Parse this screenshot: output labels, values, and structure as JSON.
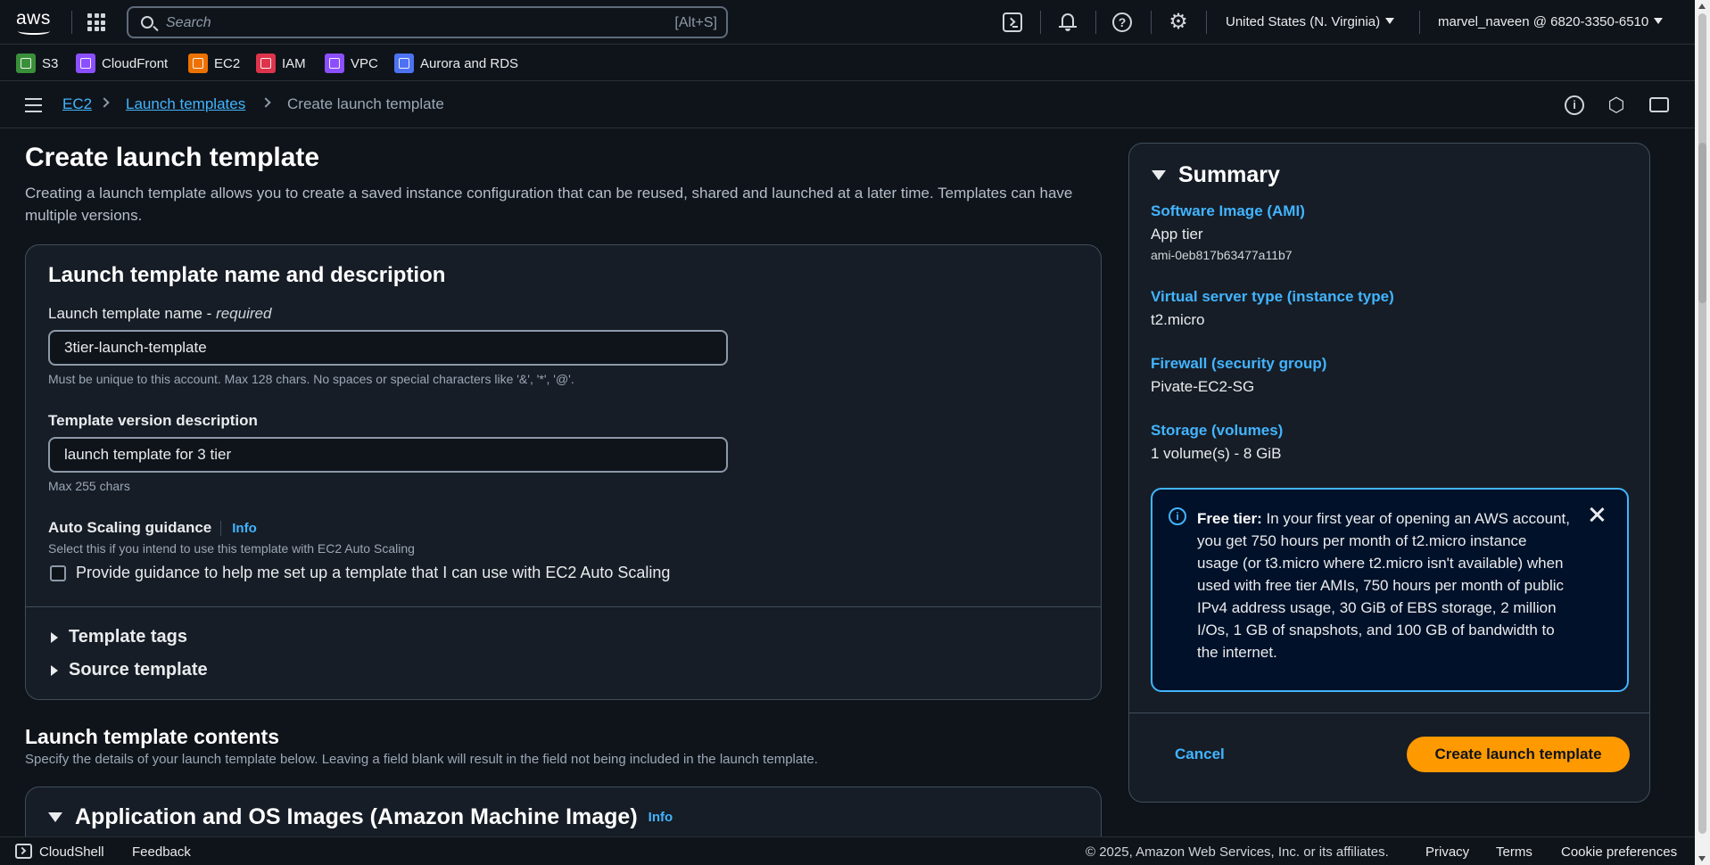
{
  "topnav": {
    "logo_text": "aws",
    "search_placeholder": "Search",
    "search_shortcut": "[Alt+S]",
    "region": "United States (N. Virginia)",
    "account": "marvel_naveen @ 6820-3350-6510"
  },
  "favorites": [
    {
      "label": "S3",
      "color": "#3a8f3a"
    },
    {
      "label": "CloudFront",
      "color": "#8c4fff"
    },
    {
      "label": "EC2",
      "color": "#ed7100"
    },
    {
      "label": "IAM",
      "color": "#dd344c"
    },
    {
      "label": "VPC",
      "color": "#8c4fff"
    },
    {
      "label": "Aurora and RDS",
      "color": "#4d72f3"
    }
  ],
  "breadcrumb": {
    "items": [
      "EC2",
      "Launch templates"
    ],
    "current": "Create launch template"
  },
  "page": {
    "title": "Create launch template",
    "description": "Creating a launch template allows you to create a saved instance configuration that can be reused, shared and launched at a later time. Templates can have multiple versions."
  },
  "name_panel": {
    "title": "Launch template name and description",
    "name_label": "Launch template name - ",
    "name_required": "required",
    "name_value": "3tier-launch-template",
    "name_hint": "Must be unique to this account. Max 128 chars. No spaces or special characters like '&', '*', '@'.",
    "version_label": "Template version description",
    "version_value": "launch template for 3 tier",
    "version_hint": "Max 255 chars",
    "asg_label": "Auto Scaling guidance",
    "asg_info": "Info",
    "asg_hint": "Select this if you intend to use this template with EC2 Auto Scaling",
    "asg_checkbox_label": "Provide guidance to help me set up a template that I can use with EC2 Auto Scaling",
    "expanders": [
      "Template tags",
      "Source template"
    ]
  },
  "contents": {
    "title": "Launch template contents",
    "description": "Specify the details of your launch template below. Leaving a field blank will result in the field not being included in the launch template.",
    "ami_title": "Application and OS Images (Amazon Machine Image)",
    "ami_info": "Info"
  },
  "summary": {
    "title": "Summary",
    "items": [
      {
        "key": "Software Image (AMI)",
        "value": "App tier",
        "sub": "ami-0eb817b63477a11b7"
      },
      {
        "key": "Virtual server type (instance type)",
        "value": "t2.micro"
      },
      {
        "key": "Firewall (security group)",
        "value": "Pivate-EC2-SG"
      },
      {
        "key": "Storage (volumes)",
        "value": "1 volume(s) - 8 GiB"
      }
    ],
    "free_tier_bold": "Free tier:",
    "free_tier_text": " In your first year of opening an AWS account, you get 750 hours per month of t2.micro instance usage (or t3.micro where t2.micro isn't available) when used with free tier AMIs, 750 hours per month of public IPv4 address usage, 30 GiB of EBS storage, 2 million I/Os, 1 GB of snapshots, and 100 GB of bandwidth to the internet.",
    "cancel": "Cancel",
    "create": "Create launch template"
  },
  "footer": {
    "cloudshell": "CloudShell",
    "feedback": "Feedback",
    "copyright": "© 2025, Amazon Web Services, Inc. or its affiliates.",
    "privacy": "Privacy",
    "terms": "Terms",
    "cookies": "Cookie preferences"
  }
}
